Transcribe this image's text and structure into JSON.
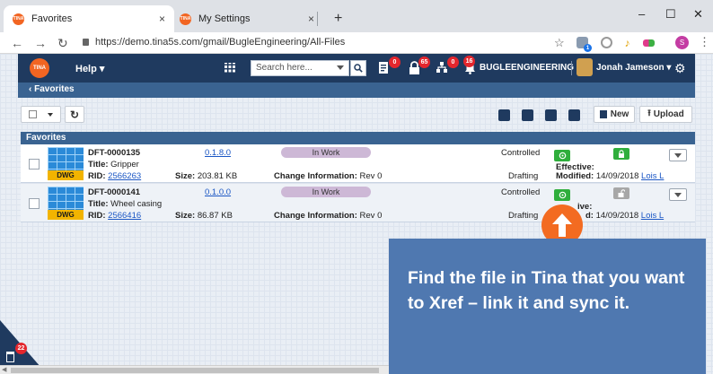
{
  "browser": {
    "tabs": [
      {
        "title": "Favorites",
        "close": "×",
        "favicon": "TINA"
      },
      {
        "title": "My Settings",
        "close": "×",
        "favicon": "TINA"
      }
    ],
    "new_tab": "+",
    "window_controls": {
      "minimize": "–",
      "maximize": "☐",
      "close": "✕"
    },
    "url": "https://demo.tina5s.com/gmail/BugleEngineering/All-Files",
    "extension_badge": "1",
    "profile_initial": "S"
  },
  "app": {
    "logo": "TINA",
    "help_label": "Help ▾",
    "search_placeholder": "Search here...",
    "badges": {
      "tasks": "0",
      "locks": "65",
      "org": "0",
      "notifications": "16"
    },
    "company": "BUGLEENGINEERING",
    "user_name": "Jonah Jameson ▾",
    "breadcrumb": "‹  Favorites",
    "toolbar": {
      "new_label": "New",
      "upload_label": "Upload"
    },
    "panel_title": "Favorites"
  },
  "files": [
    {
      "type_label": "DWG",
      "number": "DFT-0000135",
      "title_label": "Title:",
      "title": "Gripper",
      "rid_label": "RID:",
      "rid": "2566263",
      "version": "0.1.8.0",
      "size_label": "Size:",
      "size": "203.81 KB",
      "status": "In Work",
      "change_label": "Change Information:",
      "change": "Rev 0",
      "control": "Controlled",
      "stage": "Drafting",
      "effective_label": "Effective:",
      "modified_label": "Modified:",
      "modified": "14/09/2018",
      "modified_by": "Lois L"
    },
    {
      "type_label": "DWG",
      "number": "DFT-0000141",
      "title_label": "Title:",
      "title": "Wheel casing",
      "rid_label": "RID:",
      "rid": "2566416",
      "version": "0.1.0.0",
      "size_label": "Size:",
      "size": "86.87 KB",
      "status": "In Work",
      "change_label": "Change Information:",
      "change": "Rev 0",
      "control": "Controlled",
      "stage": "Drafting",
      "effective_label": "ive:",
      "modified_label": "d:",
      "modified": "14/09/2018",
      "modified_by": "Lois L"
    }
  ],
  "callout": {
    "text": "Find the file in Tina that you want to Xref – link it and sync it."
  },
  "trash_badge": "22",
  "colors": {
    "nav": "#1f3a5f",
    "breadcrumb": "#3a6391",
    "accent": "#f36b21",
    "callout": "#4f78b0",
    "green": "#2fae3c"
  }
}
